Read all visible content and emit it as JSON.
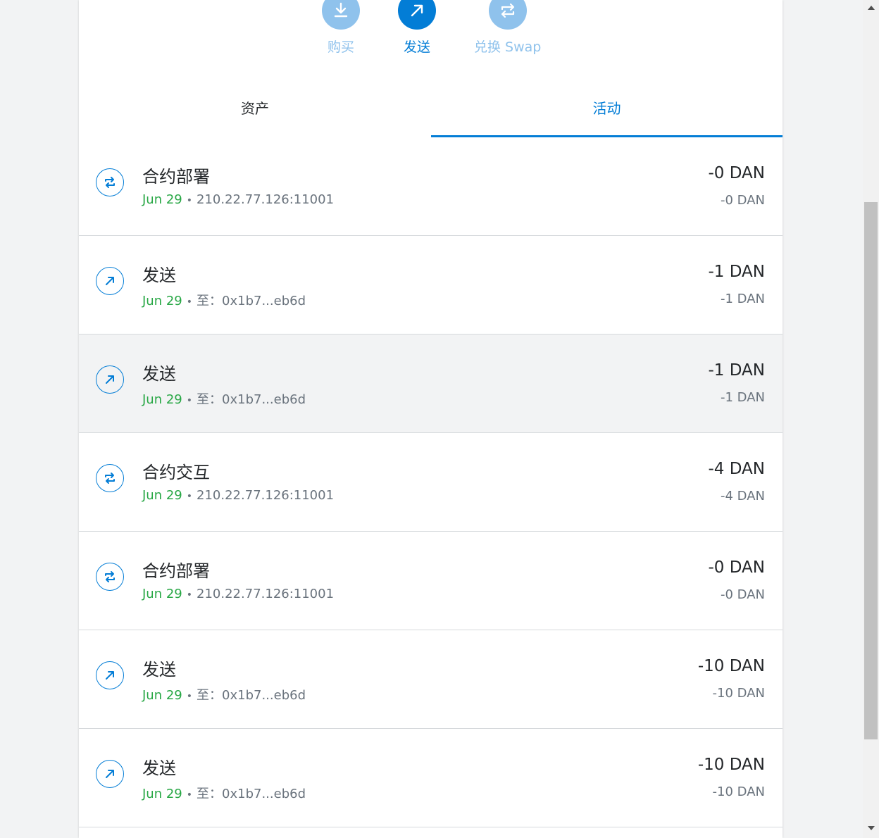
{
  "actions": {
    "buy": {
      "label": "购买"
    },
    "send": {
      "label": "发送"
    },
    "swap": {
      "label": "兑换 Swap"
    }
  },
  "tabs": {
    "assets": "资产",
    "activity": "活动"
  },
  "activity": [
    {
      "type": "contract",
      "title": "合约部署",
      "date": "Jun 29",
      "detail": "210.22.77.126:11001",
      "amount": "-0 DAN",
      "fiat": "-0 DAN"
    },
    {
      "type": "send",
      "title": "发送",
      "date": "Jun 29",
      "detail": "至：0x1b7...eb6d",
      "amount": "-1 DAN",
      "fiat": "-1 DAN"
    },
    {
      "type": "send",
      "title": "发送",
      "date": "Jun 29",
      "detail": "至：0x1b7...eb6d",
      "amount": "-1 DAN",
      "fiat": "-1 DAN"
    },
    {
      "type": "contract",
      "title": "合约交互",
      "date": "Jun 29",
      "detail": "210.22.77.126:11001",
      "amount": "-4 DAN",
      "fiat": "-4 DAN"
    },
    {
      "type": "contract",
      "title": "合约部署",
      "date": "Jun 29",
      "detail": "210.22.77.126:11001",
      "amount": "-0 DAN",
      "fiat": "-0 DAN"
    },
    {
      "type": "send",
      "title": "发送",
      "date": "Jun 29",
      "detail": "至：0x1b7...eb6d",
      "amount": "-10 DAN",
      "fiat": "-10 DAN"
    },
    {
      "type": "send",
      "title": "发送",
      "date": "Jun 29",
      "detail": "至：0x1b7...eb6d",
      "amount": "-10 DAN",
      "fiat": "-10 DAN"
    }
  ],
  "colors": {
    "accent": "#037dd6",
    "accent_disabled": "#8fc2ec",
    "date_green": "#28a745",
    "text": "#24272a",
    "muted": "#6a737d"
  }
}
